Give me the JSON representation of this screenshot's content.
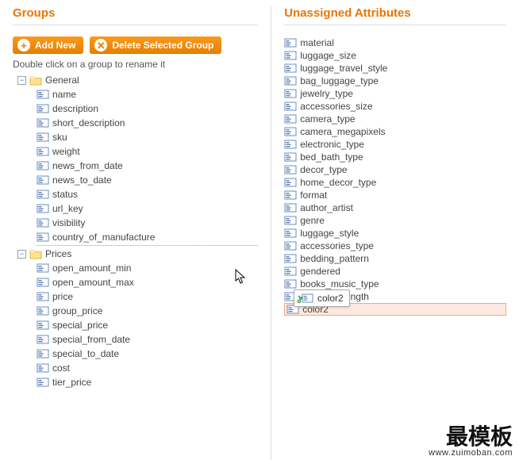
{
  "left": {
    "title": "Groups",
    "buttons": {
      "add": "Add New",
      "del": "Delete Selected Group"
    },
    "hint": "Double click on a group to rename it",
    "groups": [
      {
        "name": "General",
        "expanded": true,
        "children": [
          "name",
          "description",
          "short_description",
          "sku",
          "weight",
          "news_from_date",
          "news_to_date",
          "status",
          "url_key",
          "visibility",
          "country_of_manufacture"
        ]
      },
      {
        "name": "Prices",
        "expanded": true,
        "children": [
          "open_amount_min",
          "open_amount_max",
          "price",
          "group_price",
          "special_price",
          "special_from_date",
          "special_to_date",
          "cost",
          "tier_price"
        ]
      }
    ]
  },
  "right": {
    "title": "Unassigned Attributes",
    "items": [
      "material",
      "luggage_size",
      "luggage_travel_style",
      "bag_luggage_type",
      "jewelry_type",
      "accessories_size",
      "camera_type",
      "camera_megapixels",
      "electronic_type",
      "bed_bath_type",
      "decor_type",
      "home_decor_type",
      "format",
      "author_artist",
      "genre",
      "luggage_style",
      "accessories_type",
      "bedding_pattern",
      "gendered",
      "books_music_type",
      "necklace_length",
      "color2"
    ],
    "dragging": "color2"
  },
  "drag": {
    "label": "color2"
  },
  "watermark": {
    "zh": "最模板",
    "url": "www.zuimoban.com"
  }
}
